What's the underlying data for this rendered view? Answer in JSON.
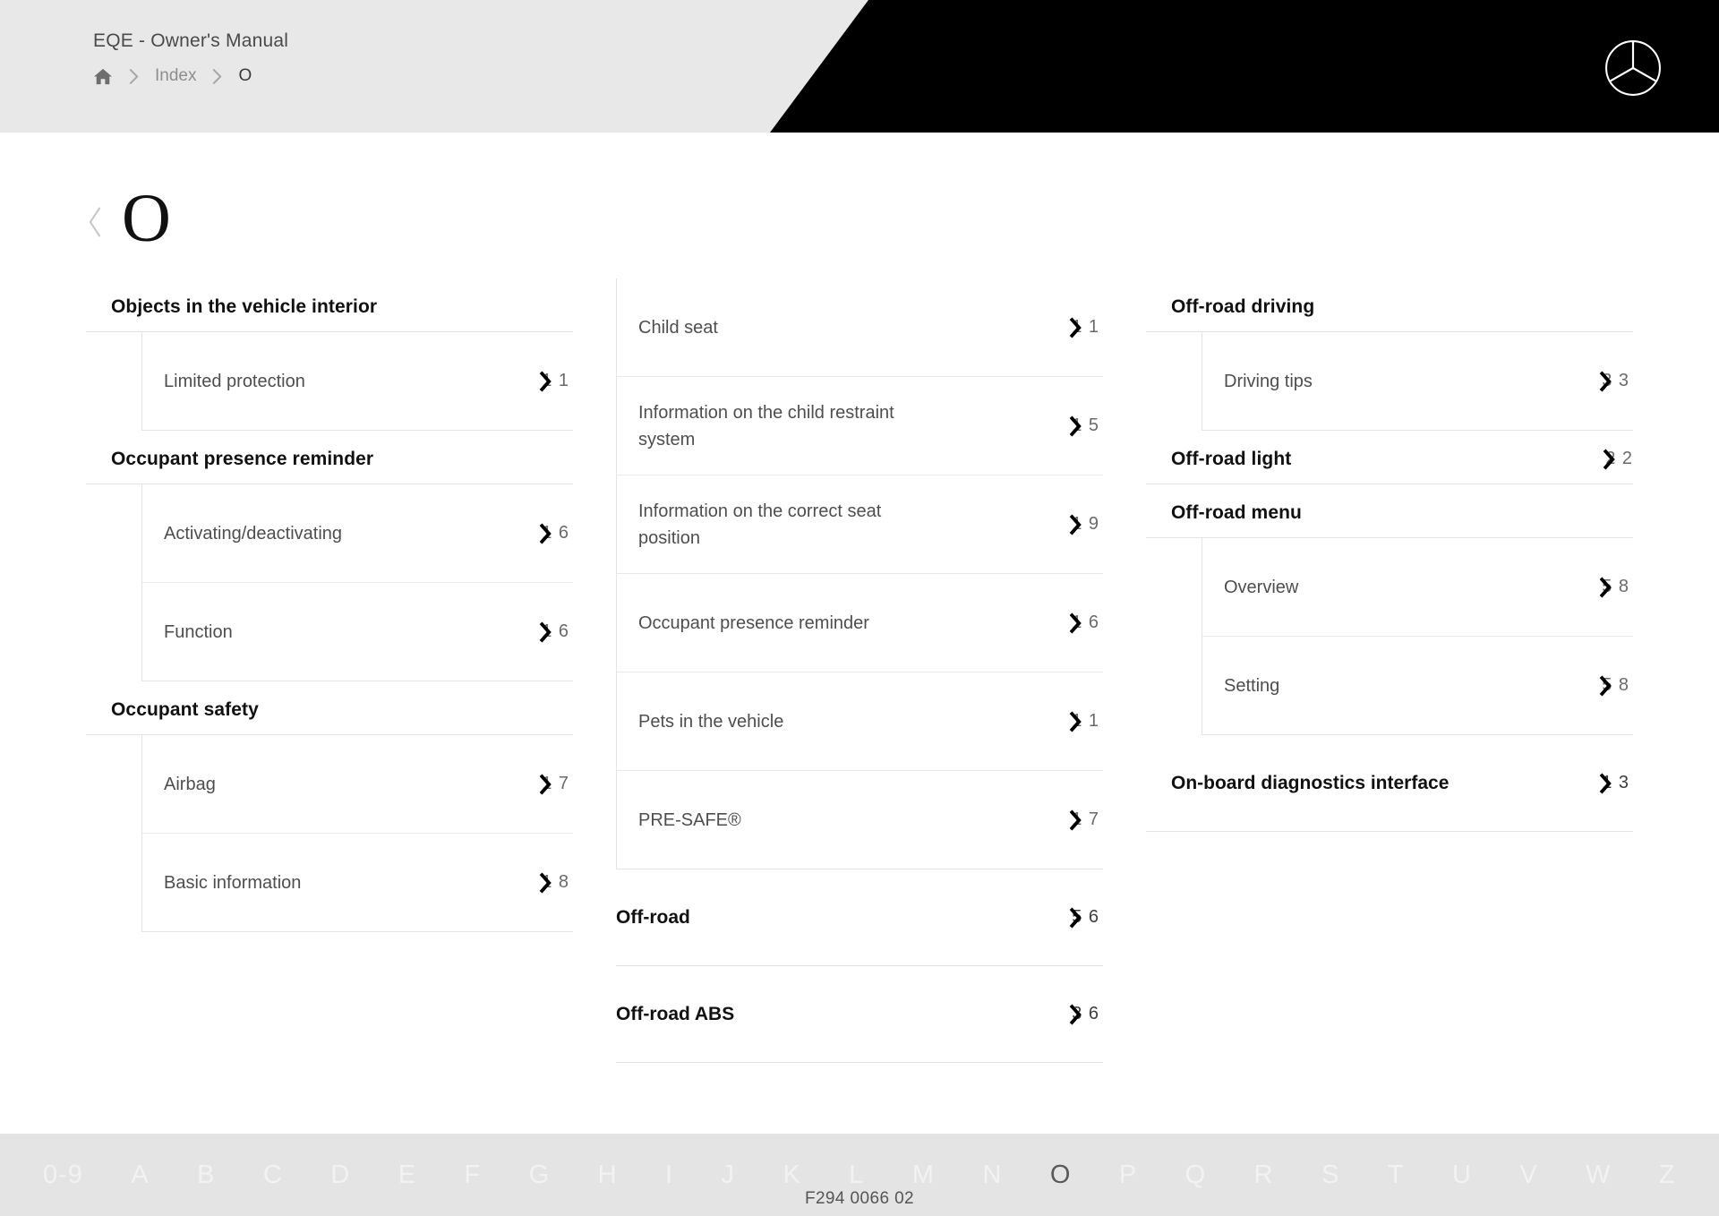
{
  "header": {
    "manual_title": "EQE - Owner's Manual",
    "breadcrumb": [
      {
        "icon": "home-icon",
        "label": ""
      },
      {
        "icon": "chevron-right-icon",
        "label": ""
      },
      {
        "icon": "",
        "label": "Index"
      },
      {
        "icon": "chevron-right-icon",
        "label": ""
      },
      {
        "icon": "",
        "label": "O"
      }
    ],
    "logo": "mercedes-benz-star-logo"
  },
  "page": {
    "back_icon": "chevron-left-icon",
    "title": "O"
  },
  "columns": [
    {
      "groups": [
        {
          "title": "Objects in the vehicle interior",
          "page": "",
          "items": [
            {
              "label": "Limited protection",
              "page": "1 1",
              "digits_left": "1",
              "digits_right": "1"
            }
          ]
        },
        {
          "title": "Occupant presence reminder",
          "page": "",
          "items": [
            {
              "label": "Activating/deactivating",
              "page": "1 6",
              "digits_left": "1",
              "digits_right": "6"
            },
            {
              "label": "Function",
              "page": "1 6",
              "digits_left": "1",
              "digits_right": "6"
            }
          ]
        },
        {
          "title": "Occupant safety",
          "page": "",
          "items": [
            {
              "label": "Airbag",
              "page": "1 7",
              "digits_left": "1",
              "digits_right": "7"
            },
            {
              "label": "Basic information",
              "page": "1 8",
              "digits_left": "1",
              "digits_right": "8"
            }
          ]
        }
      ]
    },
    {
      "groups": [
        {
          "title": "",
          "page": "",
          "items": [
            {
              "label": "Child seat",
              "page": "1 1",
              "digits_left": "1",
              "digits_right": "1"
            },
            {
              "label": "Information on the child restraint system",
              "page": "1 5",
              "digits_left": "1",
              "digits_right": "5"
            },
            {
              "label": "Information on the correct seat position",
              "page": "1 9",
              "digits_left": "1",
              "digits_right": "9"
            },
            {
              "label": "Occupant presence reminder",
              "page": "1 6",
              "digits_left": "1",
              "digits_right": "6"
            },
            {
              "label": "Pets in the vehicle",
              "page": "1 1",
              "digits_left": "1",
              "digits_right": "1"
            },
            {
              "label": "PRE-SAFE®",
              "page": "1 7",
              "digits_left": "1",
              "digits_right": "7"
            }
          ]
        }
      ],
      "top_entries": [
        {
          "label": "Off-road",
          "page": "5 6",
          "digits_left": "5",
          "digits_right": "6"
        },
        {
          "label": "Off-road ABS",
          "page": "3 6",
          "digits_left": "3",
          "digits_right": "6"
        }
      ]
    },
    {
      "groups": [
        {
          "title": "Off-road driving",
          "page": "",
          "items": [
            {
              "label": "Driving tips",
              "page": "3 3",
              "digits_left": "3",
              "digits_right": "3"
            }
          ]
        },
        {
          "title": "Off-road light",
          "page": "2 2",
          "digits_left": "2",
          "digits_right": "2",
          "items": []
        },
        {
          "title": "Off-road menu",
          "page": "",
          "items": [
            {
              "label": "Overview",
              "page": "5 8",
              "digits_left": "5",
              "digits_right": "8"
            },
            {
              "label": "Setting",
              "page": "5 8",
              "digits_left": "5",
              "digits_right": "8"
            }
          ]
        },
        {
          "title": "On-board diagnostics interface",
          "page": "1 3",
          "digits_left": "1",
          "digits_right": "3",
          "items": []
        }
      ]
    }
  ],
  "alphabet": [
    {
      "label": "0-9",
      "active": false
    },
    {
      "label": "A",
      "active": false
    },
    {
      "label": "B",
      "active": false
    },
    {
      "label": "C",
      "active": false
    },
    {
      "label": "D",
      "active": false
    },
    {
      "label": "E",
      "active": false
    },
    {
      "label": "F",
      "active": false
    },
    {
      "label": "G",
      "active": false
    },
    {
      "label": "H",
      "active": false
    },
    {
      "label": "I",
      "active": false
    },
    {
      "label": "J",
      "active": false
    },
    {
      "label": "K",
      "active": false
    },
    {
      "label": "L",
      "active": false
    },
    {
      "label": "M",
      "active": false
    },
    {
      "label": "N",
      "active": false
    },
    {
      "label": "O",
      "active": true
    },
    {
      "label": "P",
      "active": false
    },
    {
      "label": "Q",
      "active": false
    },
    {
      "label": "R",
      "active": false
    },
    {
      "label": "S",
      "active": false
    },
    {
      "label": "T",
      "active": false
    },
    {
      "label": "U",
      "active": false
    },
    {
      "label": "V",
      "active": false
    },
    {
      "label": "W",
      "active": false
    },
    {
      "label": "Z",
      "active": false
    }
  ],
  "footer": {
    "doc_code": "F294 0066 02"
  }
}
